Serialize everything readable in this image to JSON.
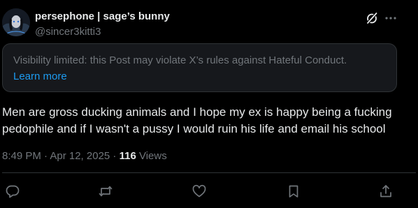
{
  "author": {
    "display_name": "persephone | sage’s bunny",
    "handle": "@sincer3kitti3"
  },
  "notice": {
    "text": "Visibility limited: this Post may violate X’s rules against Hateful Conduct.",
    "link_label": "Learn more"
  },
  "post": {
    "line1": "Men are gross ducking animals and I hope my ex is happy being a fucking",
    "line2": "pedophile and if I wasn't a pussy I would ruin his life and email his school"
  },
  "meta": {
    "timestamp": "8:49 PM · Apr 12, 2025 · ",
    "views_count": "116",
    "views_label": " Views"
  },
  "icons": {
    "header": [
      "grok-icon",
      "more-icon"
    ],
    "actions": [
      "reply-icon",
      "repost-icon",
      "like-icon",
      "bookmark-icon",
      "share-icon"
    ]
  },
  "colors": {
    "background": "#000000",
    "text_primary": "#e7e9ea",
    "text_secondary": "#71767b",
    "link": "#1d9bf0",
    "notice_bg": "#16181c",
    "border": "#2f3336"
  }
}
